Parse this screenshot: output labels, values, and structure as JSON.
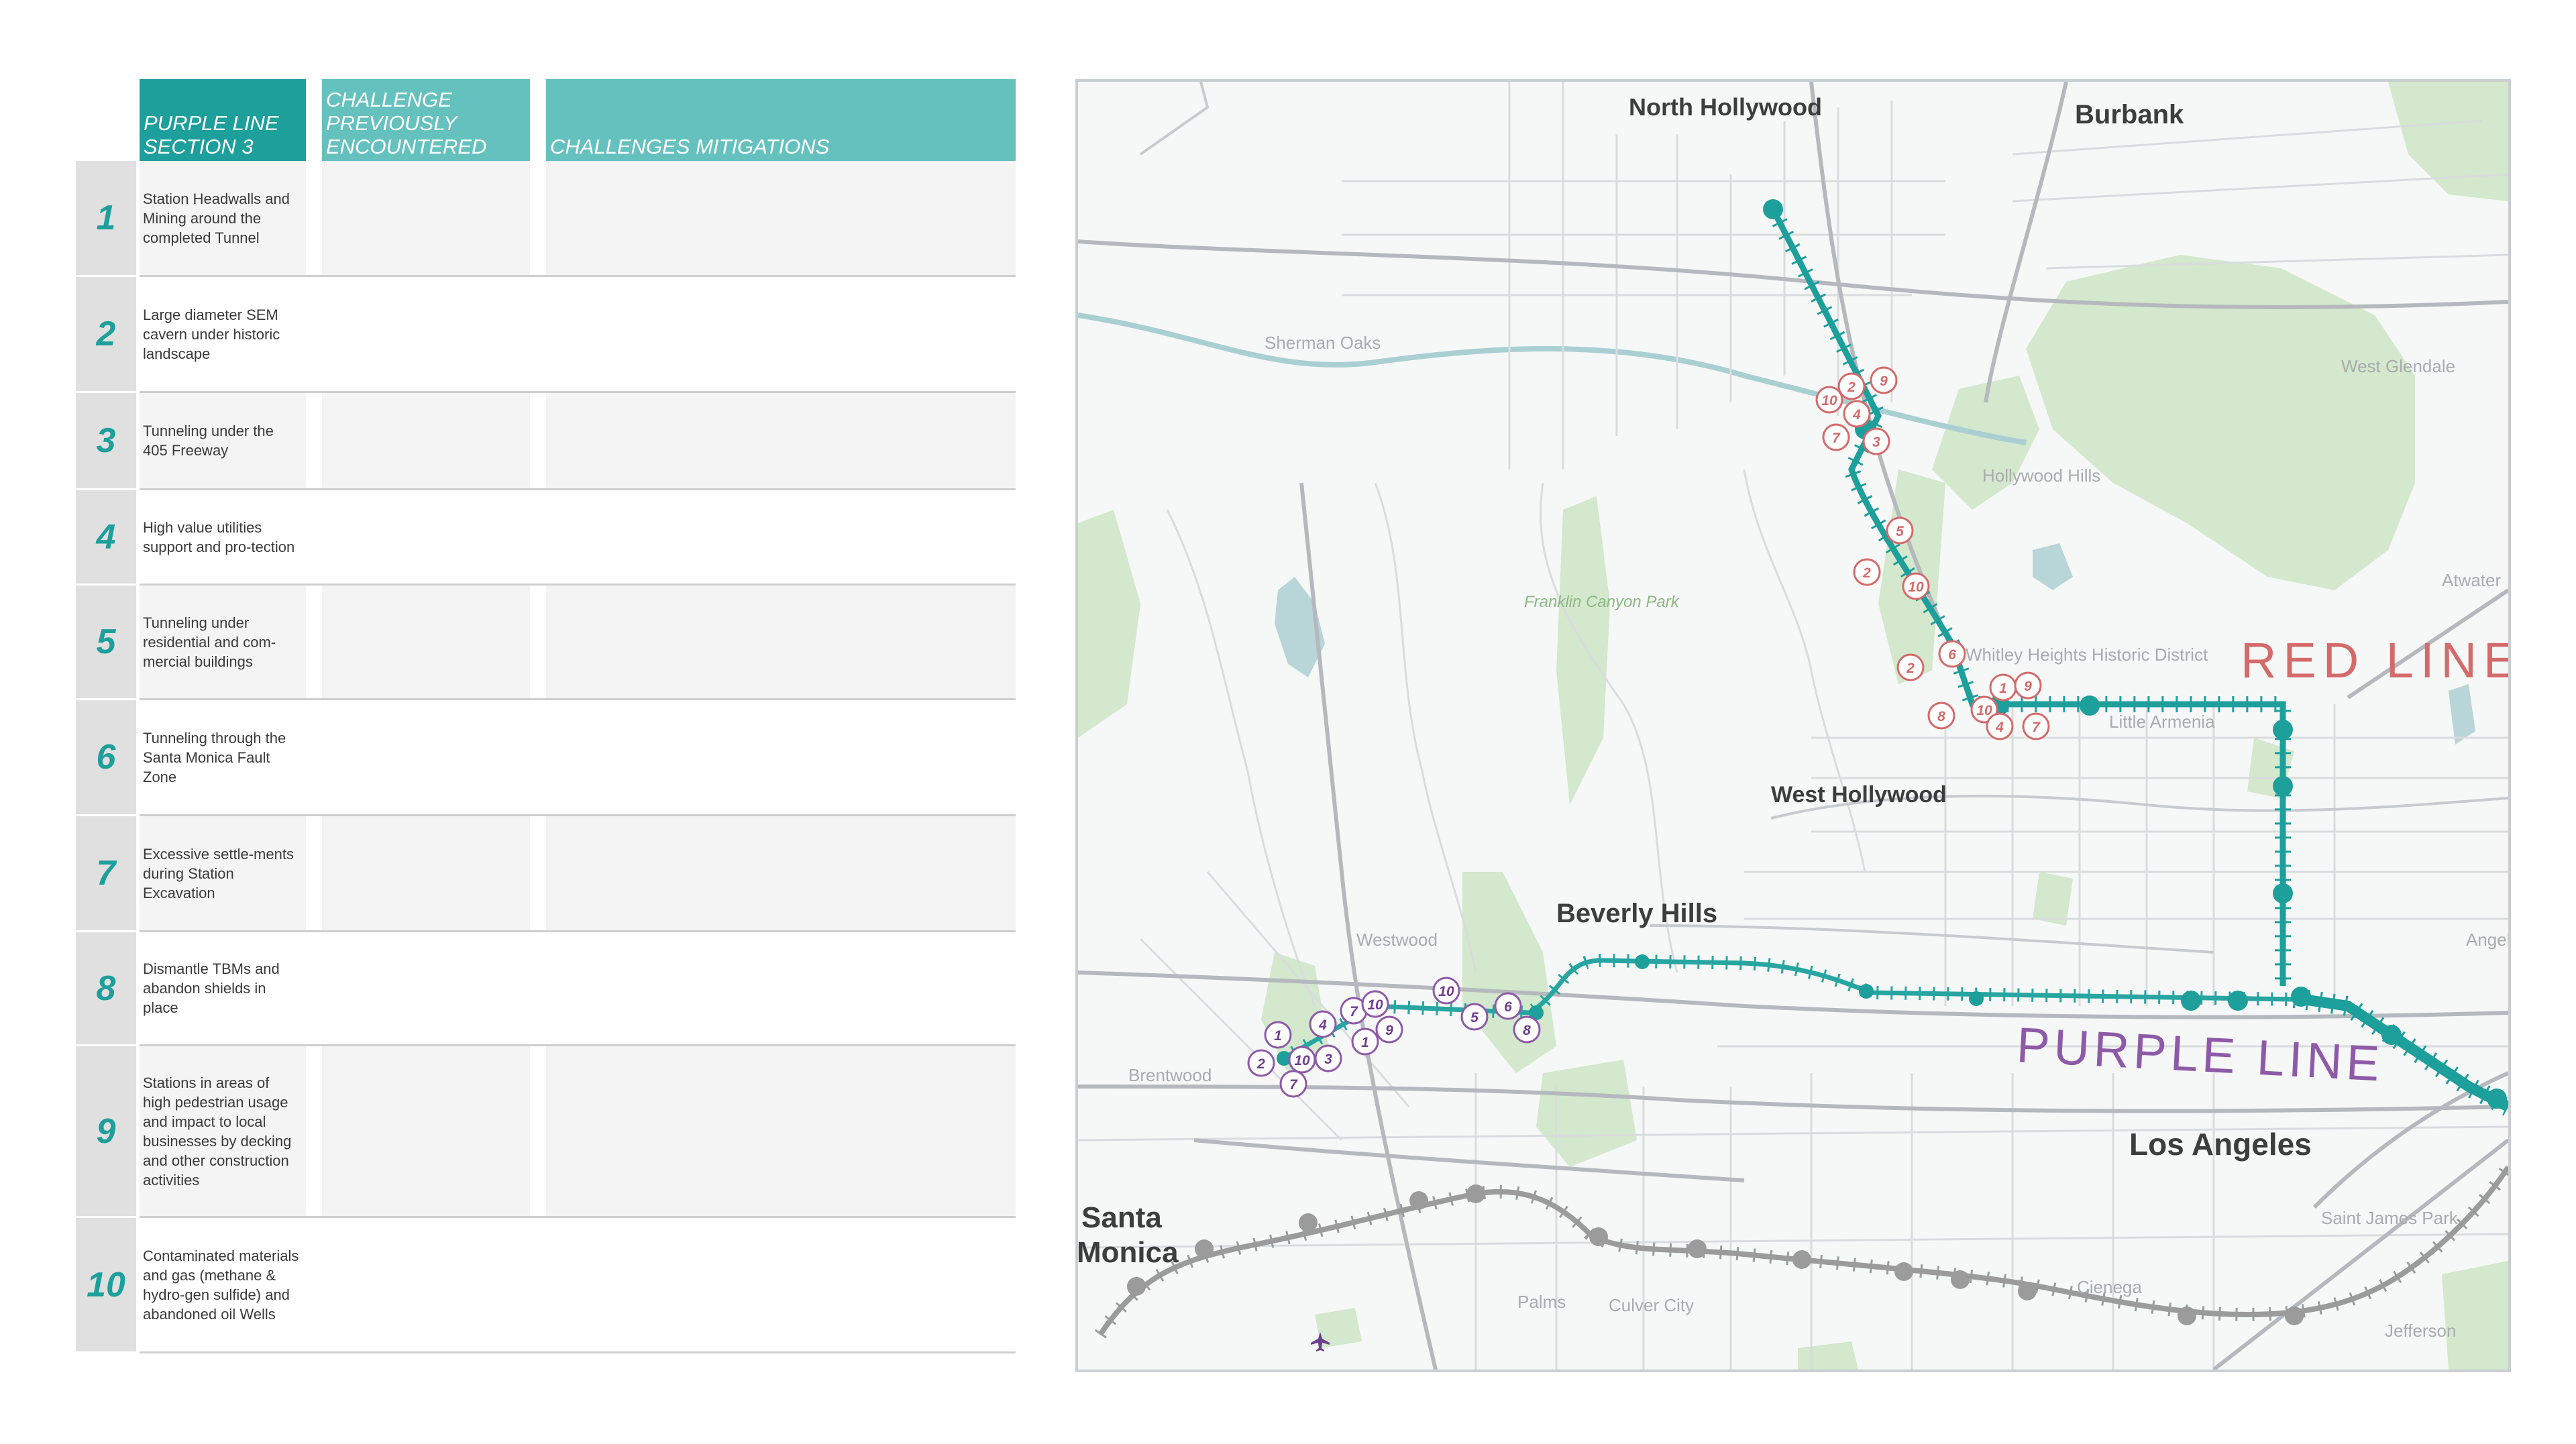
{
  "table": {
    "headers": [
      "PURPLE LINE SECTION 3",
      "CHALLENGE PREVIOUSLY ENCOUNTERED",
      "CHALLENGES MITIGATIONS"
    ],
    "rows": [
      {
        "num": "1",
        "text": "Station Headwalls and Mining around the completed Tunnel"
      },
      {
        "num": "2",
        "text": "Large diameter SEM cavern under historic landscape"
      },
      {
        "num": "3",
        "text": "Tunneling under the 405 Freeway"
      },
      {
        "num": "4",
        "text": "High value utilities support and pro-tection"
      },
      {
        "num": "5",
        "text": "Tunneling under residential and com-mercial buildings"
      },
      {
        "num": "6",
        "text": "Tunneling through the Santa Monica Fault Zone"
      },
      {
        "num": "7",
        "text": "Excessive settle-ments during Station Excavation"
      },
      {
        "num": "8",
        "text": "Dismantle TBMs and abandon shields in place"
      },
      {
        "num": "9",
        "text": "Stations in areas of high pedestrian usage and impact to local businesses by decking and other construction activities"
      },
      {
        "num": "10",
        "text": "Contaminated materials and gas (methane & hydro-gen sulfide) and abandoned oil Wells"
      }
    ]
  },
  "map": {
    "places_major": [
      "North Hollywood",
      "Burbank",
      "West Hollywood",
      "Beverly Hills",
      "Los Angeles",
      "Santa Monica"
    ],
    "places_minor": [
      "Sherman Oaks",
      "West Glendale",
      "Hollywood Hills",
      "Atwater",
      "Whitley Heights Historic District",
      "Little Armenia",
      "Westwood",
      "Brentwood",
      "Palms",
      "Culver City",
      "Cienega",
      "Saint James Park",
      "Jefferson",
      "Angelino"
    ],
    "park": "Franklin Canyon Park",
    "line_labels": {
      "red": "RED LINE",
      "purple": "PURPLE LINE"
    },
    "colors": {
      "teal": "#1d9f9b",
      "red_line": "#d46a6a",
      "purple_line": "#8e5aa8",
      "expo_line": "#9d9d9d",
      "park": "#cfe6c6",
      "water": "#b6d6da"
    },
    "red_line_markers": [
      "9",
      "2",
      "10",
      "4",
      "7",
      "3",
      "5",
      "2",
      "10",
      "6",
      "2",
      "1",
      "9",
      "8",
      "10",
      "4",
      "7"
    ],
    "purple_line_markers": [
      "1",
      "4",
      "7",
      "10",
      "2",
      "10",
      "3",
      "1",
      "9",
      "7",
      "10",
      "5",
      "6",
      "8"
    ],
    "airport_icon": "airplane-icon"
  }
}
